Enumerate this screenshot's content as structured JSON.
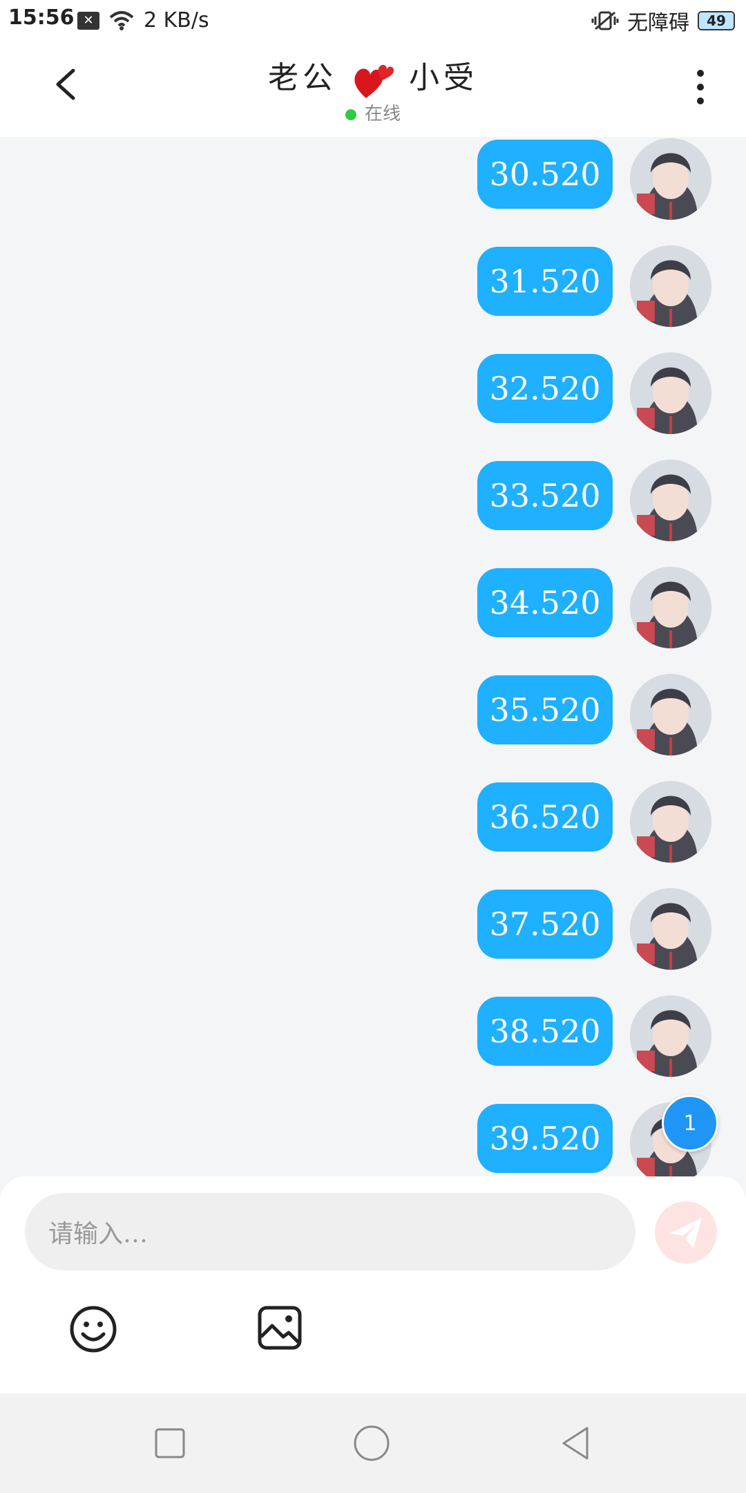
{
  "status_bar": {
    "time": "15:56",
    "net_speed": "2 KB/s",
    "accessibility": "无障碍",
    "battery": "49"
  },
  "header": {
    "title_part1": "老公",
    "title_part2": "小受",
    "status": "在线"
  },
  "messages": [
    {
      "text": "30.520"
    },
    {
      "text": "31.520"
    },
    {
      "text": "32.520"
    },
    {
      "text": "33.520"
    },
    {
      "text": "34.520"
    },
    {
      "text": "35.520"
    },
    {
      "text": "36.520"
    },
    {
      "text": "37.520"
    },
    {
      "text": "38.520"
    },
    {
      "text": "39.520"
    }
  ],
  "unread_count": "1",
  "composer": {
    "placeholder": "请输入…"
  },
  "colors": {
    "bubble": "#1fb0ff",
    "online_dot": "#2ecc40",
    "send_button": "#fde3e1"
  }
}
